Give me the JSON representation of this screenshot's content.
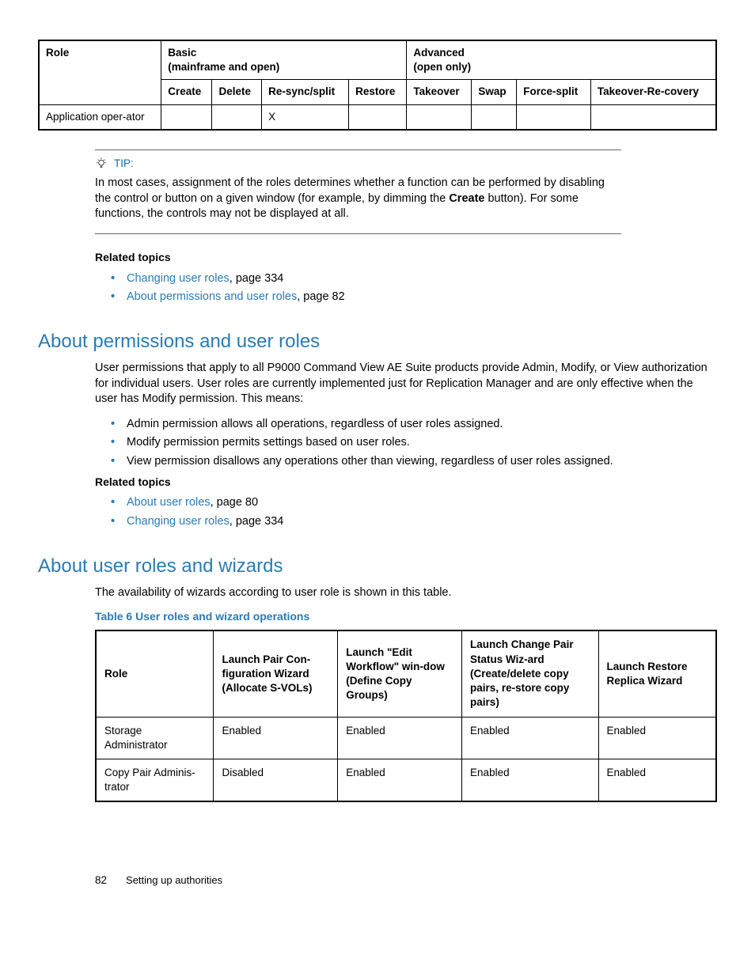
{
  "table1": {
    "header": {
      "role": "Role",
      "basic": "Basic\n(mainframe and open)",
      "advanced": "Advanced\n(open only)",
      "create": "Create",
      "delete": "Delete",
      "resync": "Re-sync/split",
      "restore": "Restore",
      "takeover": "Takeover",
      "swap": "Swap",
      "forcesplit": "Force-split",
      "takeoverrec": "Takeover-Re-covery"
    },
    "row": {
      "role": "Application oper-ator",
      "resync": "X"
    }
  },
  "tip": {
    "label": "TIP:",
    "text_before": "In most cases, assignment of the roles determines whether a function can be performed by disabling the control or button on a given window (for example, by dimming the ",
    "bold": "Create",
    "text_after": " button). For some functions, the controls may not be displayed at all."
  },
  "related1": {
    "heading": "Related topics",
    "items": [
      {
        "link": "Changing user roles",
        "suffix": ", page 334"
      },
      {
        "link": "About permissions and user roles",
        "suffix": ", page 82"
      }
    ]
  },
  "section1": {
    "title": "About permissions and user roles",
    "para": "User permissions that apply to all P9000 Command View AE Suite products provide Admin, Modify, or View authorization for individual users. User roles are currently implemented just for Replication Manager and are only effective when the user has Modify permission. This means:",
    "bullets": [
      "Admin permission allows all operations, regardless of user roles assigned.",
      "Modify permission permits settings based on user roles.",
      "View permission disallows any operations other than viewing, regardless of user roles assigned."
    ]
  },
  "related2": {
    "heading": "Related topics",
    "items": [
      {
        "link": "About user roles",
        "suffix": ", page 80"
      },
      {
        "link": "Changing user roles",
        "suffix": ", page 334"
      }
    ]
  },
  "section2": {
    "title": "About user roles and wizards",
    "para": "The availability of wizards according to user role is shown in this table.",
    "caption": "Table 6 User roles and wizard operations"
  },
  "table2": {
    "headers": {
      "role": "Role",
      "c1": "Launch Pair Con-figuration Wizard (Allocate S-VOLs)",
      "c2": "Launch \"Edit Workflow\" win-dow (Define Copy Groups)",
      "c3": "Launch Change Pair Status Wiz-ard (Create/delete copy pairs, re-store copy pairs)",
      "c4": "Launch Restore Replica Wizard"
    },
    "rows": [
      {
        "role": "Storage Administrator",
        "c1": "Enabled",
        "c2": "Enabled",
        "c3": "Enabled",
        "c4": "Enabled"
      },
      {
        "role": "Copy Pair Adminis-trator",
        "c1": "Disabled",
        "c2": "Enabled",
        "c3": "Enabled",
        "c4": "Enabled"
      }
    ]
  },
  "footer": {
    "page": "82",
    "section": "Setting up authorities"
  }
}
